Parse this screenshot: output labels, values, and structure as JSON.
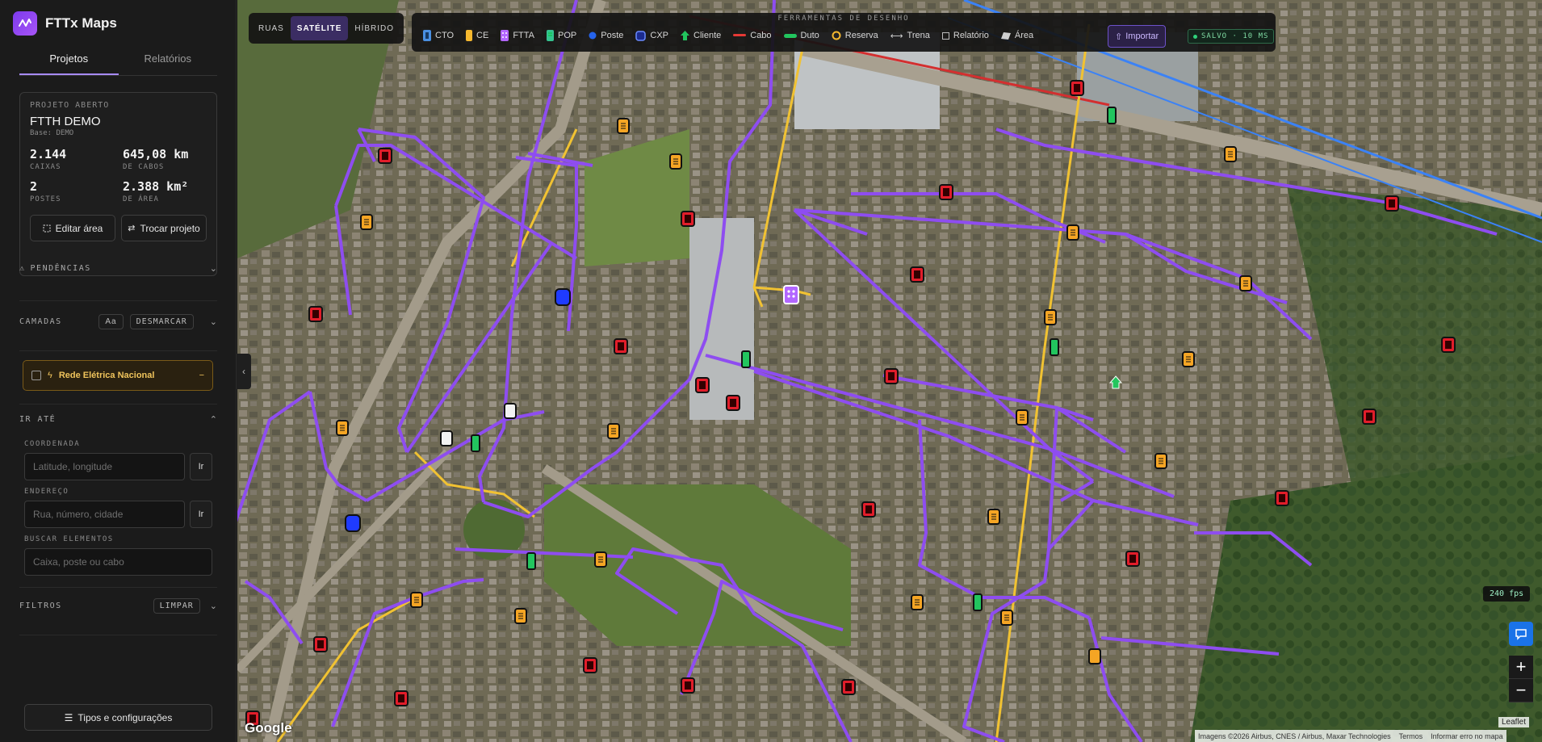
{
  "app": {
    "name": "FTTx Maps",
    "accent": "#8b5cf6"
  },
  "tabs": [
    {
      "label": "Projetos",
      "active": true
    },
    {
      "label": "Relatórios",
      "active": false
    }
  ],
  "project": {
    "eyebrow": "PROJETO ABERTO",
    "name": "FTTH DEMO",
    "base": "Base: DEMO",
    "stats": [
      {
        "value": "2.144",
        "label": "CAIXAS"
      },
      {
        "value": "645,08 km",
        "label": "DE CABOS"
      },
      {
        "value": "2",
        "label": "POSTES"
      },
      {
        "value": "2.388 km²",
        "label": "DE ÁREA"
      }
    ],
    "edit_area": "Editar área",
    "switch_project": "Trocar projeto"
  },
  "sections": {
    "pendencias": "PENDÊNCIAS",
    "camadas": "CAMADAS",
    "camadas_font_btn": "Aa",
    "camadas_uncheck_btn": "DESMARCAR",
    "ir_ate": "IR ATÉ",
    "filtros": "FILTROS",
    "filtros_clear": "LIMPAR"
  },
  "layer_card": {
    "label": "Rede Elétrica Nacional",
    "color": "#f0c45c"
  },
  "goto": {
    "coord_label": "COORDENADA",
    "coord_placeholder": "Latitude, longitude",
    "address_label": "ENDEREÇO",
    "address_placeholder": "Rua, número, cidade",
    "search_label": "BUSCAR ELEMENTOS",
    "search_placeholder": "Caixa, poste ou cabo",
    "go_label": "Ir"
  },
  "settings_button": "Tipos e configurações",
  "map_view": {
    "options": [
      {
        "label": "RUAS",
        "active": false
      },
      {
        "label": "SATÉLITE",
        "active": true
      },
      {
        "label": "HÍBRIDO",
        "active": false
      }
    ]
  },
  "toolbar": {
    "title": "FERRAMENTAS DE DESENHO",
    "tools": [
      {
        "label": "CTO",
        "icon": "cto-icon",
        "color": "#4a90e2"
      },
      {
        "label": "CE",
        "icon": "ce-icon",
        "color": "#f5b82e"
      },
      {
        "label": "FTTA",
        "icon": "ftta-icon",
        "color": "#b266ff"
      },
      {
        "label": "POP",
        "icon": "pop-icon",
        "color": "#34c38f"
      },
      {
        "label": "Poste",
        "icon": "poste-icon",
        "color": "#2563eb"
      },
      {
        "label": "CXP",
        "icon": "cxp-icon",
        "color": "#3b5bff"
      },
      {
        "label": "Cliente",
        "icon": "cliente-icon",
        "color": "#22c55e"
      },
      {
        "label": "Cabo",
        "icon": "cabo-icon",
        "color": "#e53935"
      },
      {
        "label": "Duto",
        "icon": "duto-icon",
        "color": "#22c55e"
      },
      {
        "label": "Reserva",
        "icon": "reserva-icon",
        "color": "#f5b82e"
      },
      {
        "label": "Trena",
        "icon": "trena-icon",
        "color": "#d0d0d0"
      },
      {
        "label": "Relatório",
        "icon": "relatorio-icon",
        "color": "#d0d0d0"
      },
      {
        "label": "Área",
        "icon": "area-icon",
        "color": "#d0d0d0"
      }
    ],
    "import_label": "Importar",
    "saved_label": "SALVO · 10 MS"
  },
  "overlay": {
    "fps": "240 fps",
    "google": "Google",
    "leaflet": "Leaflet",
    "attribution": [
      "Imagens ©2026 Airbus, CNES / Airbus, Maxar Technologies",
      "Termos",
      "Informar erro no mapa"
    ]
  },
  "colors": {
    "cable_purple": "#8e4df0",
    "cable_yellow": "#f1c232",
    "cable_red": "#d32f2f",
    "cable_blue": "#3b82f6",
    "cto_red": "#e11d2a",
    "ce_orange": "#f5a524"
  }
}
